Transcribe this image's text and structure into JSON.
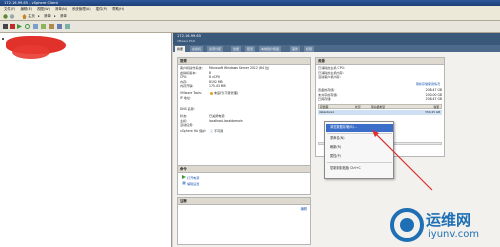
{
  "window": {
    "title": "172.16.99.65 - vSphere Client"
  },
  "menu": [
    "文件(F)",
    "编辑(E)",
    "视图(W)",
    "清单(N)",
    "系统管理(A)",
    "插件(P)",
    "帮助(H)"
  ],
  "nav": {
    "home": "主页",
    "sep": "▸",
    "inventory": "清单",
    "crumb": "清单"
  },
  "host": {
    "name": "172.16.99.65",
    "subtitle": "VMware ESXi"
  },
  "tabs": [
    "摘要",
    "虚拟机",
    "资源分配",
    "性能",
    "配置",
    "本地用户和组",
    "事件",
    "权限"
  ],
  "general": {
    "header": "常规",
    "rows": [
      {
        "k": "客户机操作系统:",
        "v": "Microsoft Windows Server 2012 (64 位)"
      },
      {
        "k": "虚拟机版本:",
        "v": "8"
      },
      {
        "k": "CPU:",
        "v": "8 vCPU"
      },
      {
        "k": "内存:",
        "v": "8192 MB"
      },
      {
        "k": "内存开销:",
        "v": "175.43 MB"
      },
      {
        "k": "VMware Tools:",
        "v": "未运行(不受管理)"
      },
      {
        "k": "IP 地址:",
        "v": ""
      },
      {
        "k": "DNS 名称:",
        "v": ""
      },
      {
        "k": "状态:",
        "v": "已关闭电源"
      },
      {
        "k": "主机:",
        "v": "localhost.localdomain"
      },
      {
        "k": "活动任务:",
        "v": ""
      },
      {
        "k": "vSphere HA 保护:",
        "v": "不可用"
      }
    ]
  },
  "commands": {
    "header": "命令",
    "power_on": "打开电源",
    "edit_settings": "编辑设置"
  },
  "notes": {
    "header": "注释",
    "edit": "编辑"
  },
  "resources": {
    "header": "资源",
    "rows": [
      {
        "k": "已消耗的主机 CPU:",
        "v": ""
      },
      {
        "k": "已消耗的主机内存:",
        "v": ""
      },
      {
        "k": "活动客户机内存:",
        "v": ""
      }
    ],
    "refresh": "刷新存储使用情况",
    "storage": [
      {
        "k": "置备的存储:",
        "v": "208.47 GB"
      },
      {
        "k": "未共享的存储:",
        "v": "200.00 GB"
      },
      {
        "k": "已用存储:",
        "v": "208.47 GB"
      }
    ],
    "table_headers": [
      "存储器",
      "状况",
      "驱动器类型",
      "容量"
    ],
    "table_row": [
      "datastore1",
      "",
      "",
      "550.25 GB"
    ]
  },
  "context_menu": {
    "items": [
      "浏览数据存储(B)...",
      "重命名(N)",
      "刷新(R)",
      "属性(P)",
      "复制到剪贴板  Ctrl+C"
    ]
  },
  "watermark": {
    "cn": "运维网",
    "url": "iyunv.com"
  },
  "colors": {
    "accent": "#3a587a",
    "highlight": "#3a6ec9",
    "arrow": "#d83030"
  }
}
